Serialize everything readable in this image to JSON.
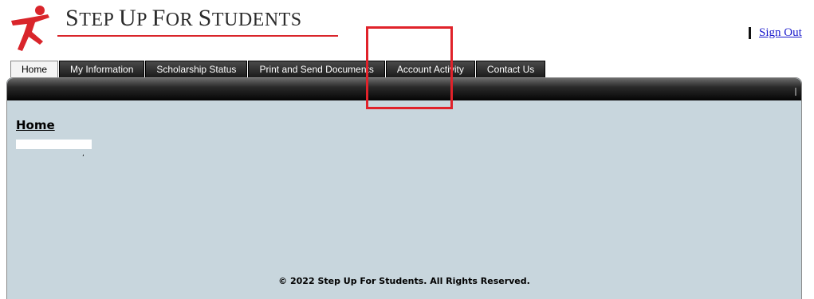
{
  "header": {
    "logo": {
      "text_big_1": "S",
      "text_small_1": "TEP ",
      "text_big_2": "U",
      "text_small_2": "P ",
      "text_big_3": "F",
      "text_small_3": "OR ",
      "text_big_4": "S",
      "text_small_4": "TUDENTS",
      "icon": "running-figure-icon"
    },
    "separator": "|",
    "signout_label": "Sign Out"
  },
  "tabs": [
    {
      "label": "Home",
      "active": true
    },
    {
      "label": "My Information",
      "active": false
    },
    {
      "label": "Scholarship Status",
      "active": false
    },
    {
      "label": "Print and Send Documents",
      "active": false
    },
    {
      "label": "Account Activity",
      "active": false
    },
    {
      "label": "Contact Us",
      "active": false
    }
  ],
  "main": {
    "title": "Home",
    "footer": "© 2022 Step Up For Students. All Rights Reserved."
  },
  "colors": {
    "brand_red": "#d9252b",
    "panel_bg": "#c8d6dd",
    "highlight": "#e0222a"
  }
}
